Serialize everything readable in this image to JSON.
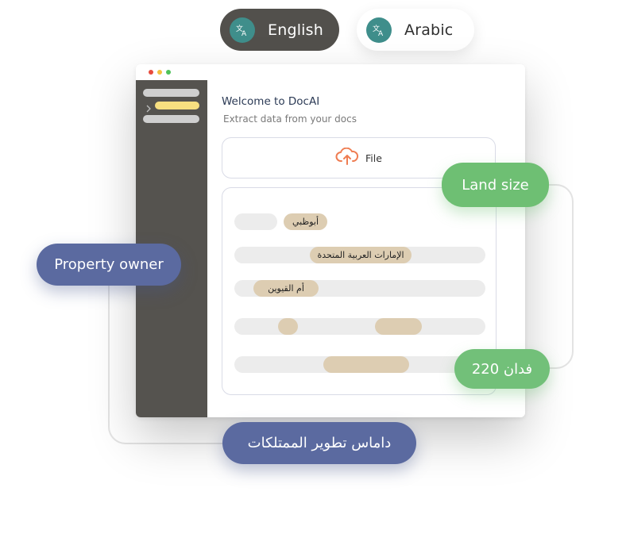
{
  "language_switcher": {
    "english_label": "English",
    "arabic_label": "Arabic"
  },
  "window": {
    "title": "Welcome to DocAI",
    "subtitle": "Extract data from your docs",
    "upload": {
      "label": "File",
      "icon": "cloud-upload-icon"
    },
    "extracted_values": [
      "أبوظبي",
      "الإمارات العربية المتحدة",
      "أم القيوين"
    ]
  },
  "tags": {
    "land_size": "Land size",
    "land_size_value": "220 فدان",
    "property_owner": "Property owner",
    "property_owner_value": "داماس تطوير الممتلكات"
  },
  "colors": {
    "accent_green": "#6ebf73",
    "accent_blue": "#5b6aa0",
    "upload_orange": "#ef7d52",
    "translate_teal": "#3f8e8b",
    "chip_beige": "#ddcdb2",
    "sidebar_dark": "#55534f",
    "sidebar_highlight": "#f7df80"
  }
}
